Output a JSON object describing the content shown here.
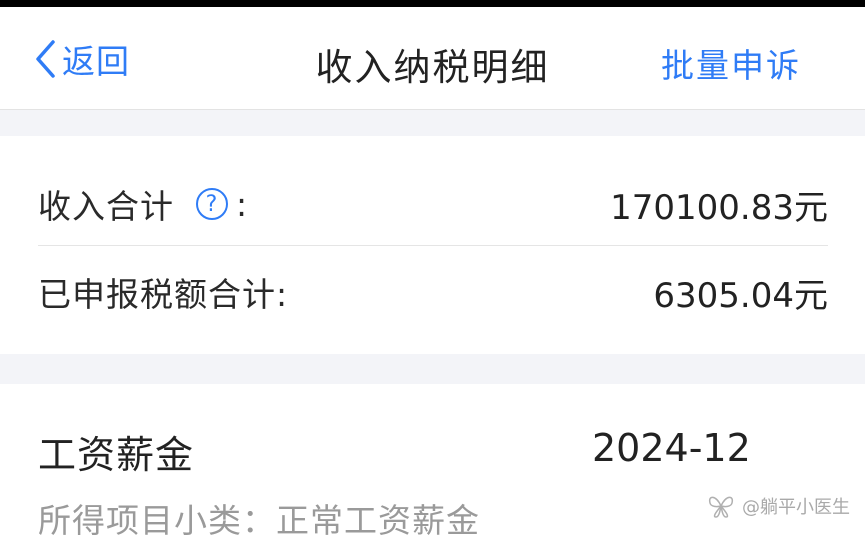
{
  "nav": {
    "back_label": "返回",
    "title": "收入纳税明细",
    "action_label": "批量申诉"
  },
  "summary": {
    "income_label": "收入合计",
    "income_colon": ":",
    "income_value": "170100.83元",
    "tax_label": "已申报税额合计:",
    "tax_value": "6305.04元"
  },
  "item": {
    "title": "工资薪金",
    "date": "2024-12",
    "subtitle": "所得项目小类：正常工资薪金"
  },
  "watermark": {
    "text": "@躺平小医生"
  },
  "colors": {
    "accent": "#2f7cf6",
    "section_gap": "#f3f4f8",
    "secondary_text": "#9a9a9a"
  },
  "icons": [
    "back-chevron-icon",
    "help-question-icon",
    "butterfly-watermark-icon"
  ]
}
